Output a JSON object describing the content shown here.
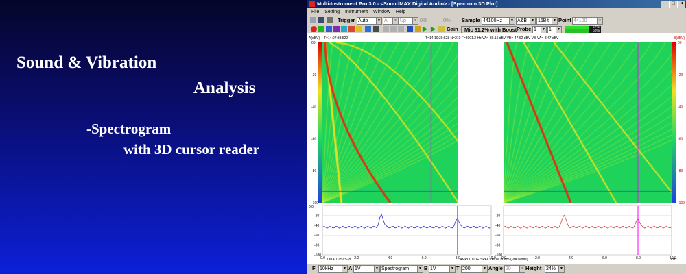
{
  "slide": {
    "title_line1": "Sound & Vibration",
    "title_line2": "Analysis",
    "subtitle_line1": "-Spectrogram",
    "subtitle_line2": "with 3D cursor reader"
  },
  "window": {
    "title": "Multi-Instrument Pro 3.0 - <SoundMAX Digital Audio> - [Spectrum 3D Plot]",
    "min": "_",
    "max": "□",
    "close": "×"
  },
  "menu": [
    "File",
    "Setting",
    "Instrument",
    "Window",
    "Help"
  ],
  "toolbar1": {
    "trigger_label": "Trigger",
    "trigger_value": "Auto",
    "channel_value": "A",
    "edge_value": "Up",
    "level1": "0%",
    "level2": "0%",
    "sample_label": "Sample",
    "sample_value": "44100Hz",
    "channels_value": "A&B",
    "bits_value": "16Bit",
    "point_label": "Point",
    "point_value": "44100"
  },
  "toolbar2": {
    "gain_label": "Gain",
    "mic_text": "Mic 81.2% with Boost",
    "probe_label": "Probe",
    "probe_a": "1",
    "probe_b": "1",
    "level_a": "67%",
    "level_b": "68%"
  },
  "plot": {
    "top_left_time": "T=14:07:33:522",
    "top_info": "T=14:10:36:528  N=210  F=8001.2 Hz  VA=-39.15 dBV  VB=-47.62 dBV  VB-VA=-8.47 dBV",
    "left_unit": "A(dBV)",
    "right_unit": "B(dBV)",
    "yticks": [
      "00",
      "-20",
      "-40",
      "-60",
      "-80",
      "-100"
    ],
    "ytick_values": [
      0,
      -20,
      -40,
      -60,
      -80,
      -100
    ],
    "spec_yticks": [
      "-20",
      "-40",
      "-60",
      "-80",
      "-100"
    ],
    "spec_ytick_values": [
      -20,
      -40,
      -60,
      -80,
      -100
    ],
    "spec_top": "0.0",
    "xticks_left": [
      "0.0",
      "2.0",
      "4.0",
      "6.0",
      "8.0",
      "10.0"
    ],
    "xticks_right": [
      "0.0",
      "2.0",
      "4.0",
      "6.0",
      "8.0",
      "10.0"
    ],
    "xtick_values": [
      0,
      2,
      4,
      6,
      8,
      10
    ],
    "bottom_time": "T=14:10:52:528",
    "bottom_title": "AMPLITUDE SPECTRUM in dBV(Vr=1Vrms)",
    "khz": "kHz",
    "cursor_khz": 8.0,
    "cursor_time_frac": 0.93,
    "peak_khz_left": 3.5,
    "peak_khz_right": 3.6
  },
  "statusbar": {
    "f_label": "F",
    "f_value": "10kHz",
    "a_label": "A",
    "a_value": "1V",
    "mode_value": "Spectrogram",
    "b_label": "B",
    "b_value": "1V",
    "t_label": "T",
    "t_value": "200",
    "angle_label": "Angle",
    "angle_value": "20",
    "height_label": "Height",
    "height_value": "24%"
  },
  "colors": {
    "spectrogram_bg": "#1fd35a",
    "trace_a": "#2f2fc8",
    "trace_b": "#d44040",
    "cursor": "#ff00ff",
    "crosshair": "#2060d0"
  }
}
